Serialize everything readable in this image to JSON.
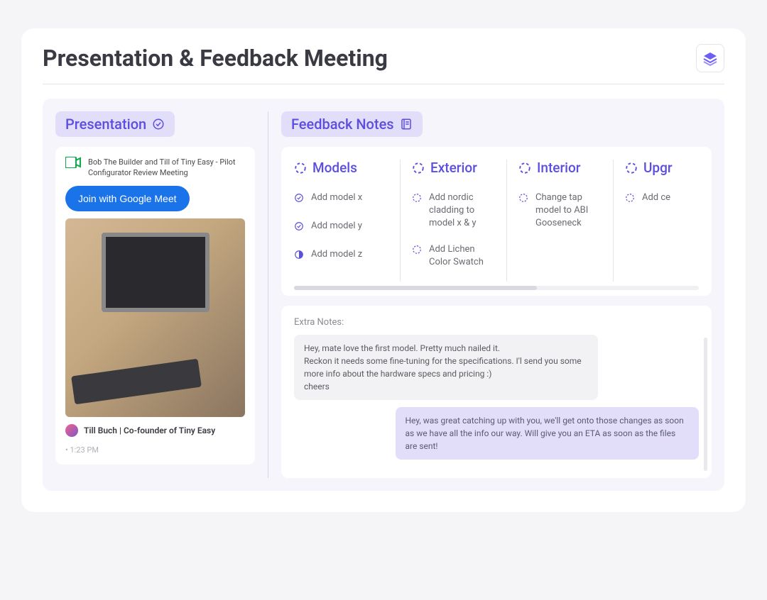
{
  "title": "Presentation & Feedback Meeting",
  "presentation": {
    "pill_label": "Presentation",
    "meeting_title": "Bob The Builder and Till of Tiny Easy - Pilot Configurator Review Meeting",
    "join_label": "Join with Google Meet",
    "author": "Till Buch | Co-founder of Tiny Easy",
    "time": "1:23 PM"
  },
  "feedback": {
    "pill_label": "Feedback Notes",
    "columns": [
      {
        "title": "Models",
        "tasks": [
          {
            "status": "done",
            "text": "Add model x"
          },
          {
            "status": "done",
            "text": "Add model y"
          },
          {
            "status": "inprogress",
            "text": "Add model z"
          }
        ]
      },
      {
        "title": "Exterior",
        "tasks": [
          {
            "status": "todo",
            "text": "Add nordic cladding to model x & y"
          },
          {
            "status": "todo",
            "text": "Add Lichen Color Swatch"
          }
        ]
      },
      {
        "title": "Interior",
        "tasks": [
          {
            "status": "todo",
            "text": "Change tap model to ABI Gooseneck"
          }
        ]
      },
      {
        "title": "Upgr",
        "tasks": [
          {
            "status": "todo",
            "text": "Add ce"
          }
        ]
      }
    ]
  },
  "notes": {
    "label": "Extra Notes:",
    "messages": [
      {
        "side": "left",
        "text": "Hey, mate love the first model. Pretty much nailed it.\nReckon it needs some fine-tuning for the specifications. I'l send you some more info about the hardware specs and pricing :)\ncheers"
      },
      {
        "side": "right",
        "text": "Hey, was great catching up with you, we'll get onto those changes as soon as we have all the info our way. Will give you an ETA as soon as the files are sent!"
      }
    ]
  }
}
